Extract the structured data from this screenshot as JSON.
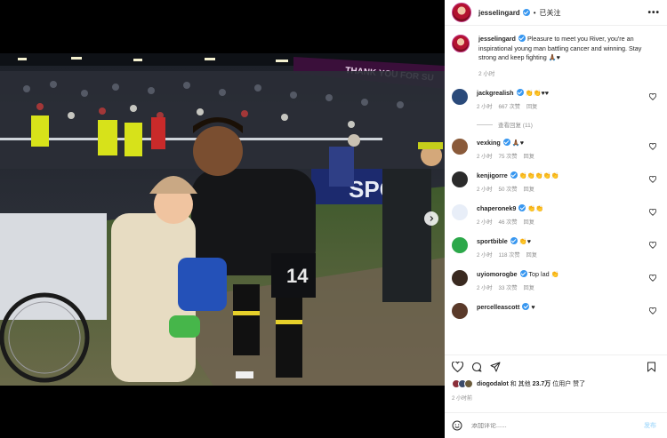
{
  "post": {
    "author": "jesselingard",
    "follow_state": "已关注",
    "more_label": "•••"
  },
  "caption": {
    "username": "jesselingard",
    "text": "Pleasure to meet you River, you're an inspirational young man battling cancer and winning. Stay strong and keep fighting 🙏🏾♥",
    "time": "2 小时"
  },
  "photo": {
    "banner_text": "THANK YOU FOR SU",
    "jersey_number": "14",
    "board_text": "SPO"
  },
  "comments": [
    {
      "user": "jackgrealish",
      "verified": true,
      "text": "👏👏♥♥",
      "time": "2 小时",
      "likes": "667 次赞",
      "reply": "回复",
      "avatar_color": "#2a4a7a"
    },
    {
      "user": "vexking",
      "verified": true,
      "text": "🙏🏾♥",
      "time": "2 小时",
      "likes": "75 次赞",
      "reply": "回复",
      "avatar_color": "#8a5a3a"
    },
    {
      "user": "kenjigorre",
      "verified": true,
      "text": "👏👏👏👏👏",
      "time": "2 小时",
      "likes": "50 次赞",
      "reply": "回复",
      "avatar_color": "#2b2b2b"
    },
    {
      "user": "chaperonek9",
      "verified": true,
      "text": "👏👏",
      "time": "2 小时",
      "likes": "46 次赞",
      "reply": "回复",
      "avatar_color": "#e8eef8"
    },
    {
      "user": "sportbible",
      "verified": true,
      "text": "👏♥",
      "time": "2 小时",
      "likes": "118 次赞",
      "reply": "回复",
      "avatar_color": "#2ca84a"
    },
    {
      "user": "uyiomorogbe",
      "verified": true,
      "text": "Top lad 👏",
      "time": "2 小时",
      "likes": "33 次赞",
      "reply": "回复",
      "avatar_color": "#3a2a20"
    },
    {
      "user": "percelleascott",
      "verified": true,
      "text": "♥",
      "time": "",
      "likes": "",
      "reply": "",
      "avatar_color": "#5a3a2a"
    }
  ],
  "view_replies": "查看回复 (11)",
  "likes": {
    "first_user": "diogodalot",
    "connector": "和 其他",
    "count": "23.7万",
    "suffix": "位用户 赞了"
  },
  "post_time": "2 小时前",
  "add_comment": {
    "placeholder": "添加评论......",
    "post_label": "发布"
  },
  "colors": {
    "verified": "#3897f0",
    "post_button": "#b2dffc",
    "muted_text": "#8e8e8e"
  }
}
